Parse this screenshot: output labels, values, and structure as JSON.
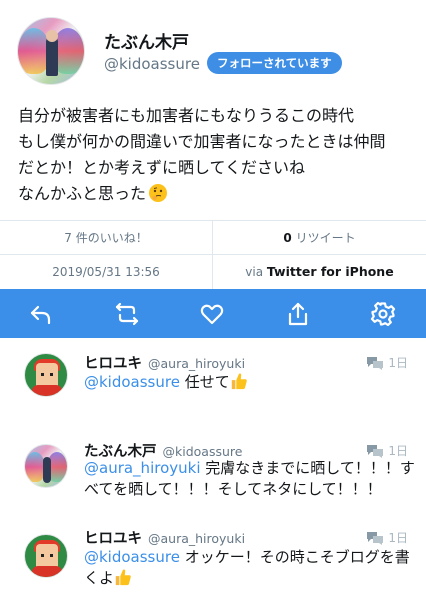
{
  "author": {
    "display_name": "たぶん木戸",
    "handle": "@kidoassure",
    "follow_status": "フォローされています"
  },
  "tweet": {
    "lines": [
      "自分が被害者にも加害者にもなりうるこの時代",
      "もし僕が何かの間違いで加害者になったときは仲間",
      "だとか！とか考えずに晒してくださいね",
      "なんかふと思った"
    ],
    "trailing_emoji": "thinking-face-emoji"
  },
  "stats": {
    "likes_label": "7 件のいいね！",
    "retweets_count": "0",
    "retweets_label": "リツイート",
    "timestamp": "2019/05/31 13:56",
    "via_prefix": "via",
    "via_client": "Twitter for iPhone"
  },
  "actions": [
    {
      "name": "reply-icon"
    },
    {
      "name": "retweet-icon"
    },
    {
      "name": "like-icon"
    },
    {
      "name": "share-icon"
    },
    {
      "name": "settings-icon"
    }
  ],
  "colors": {
    "accent": "#3b8fe8",
    "follow_badge": "#3e8ee6",
    "secondary_text": "#657786"
  },
  "replies": [
    {
      "name": "ヒロユキ",
      "handle": "@aura_hiroyuki",
      "time": "1日",
      "mention": "@kidoassure",
      "text": "任せて",
      "emoji": "thumbs-up-emoji"
    },
    {
      "name": "たぶん木戸",
      "handle": "@kidoassure",
      "time": "1日",
      "mention": "@aura_hiroyuki",
      "text_line1": "完膚なきまでに晒して！！！す",
      "text_line2": "べてを晒して！！！そしてネタにして！！！"
    },
    {
      "name": "ヒロユキ",
      "handle": "@aura_hiroyuki",
      "time": "1日",
      "mention": "@kidoassure",
      "text_line1": "オッケー！その時こそブログを書",
      "text_line2": "くよ",
      "emoji": "thumbs-up-emoji"
    }
  ]
}
